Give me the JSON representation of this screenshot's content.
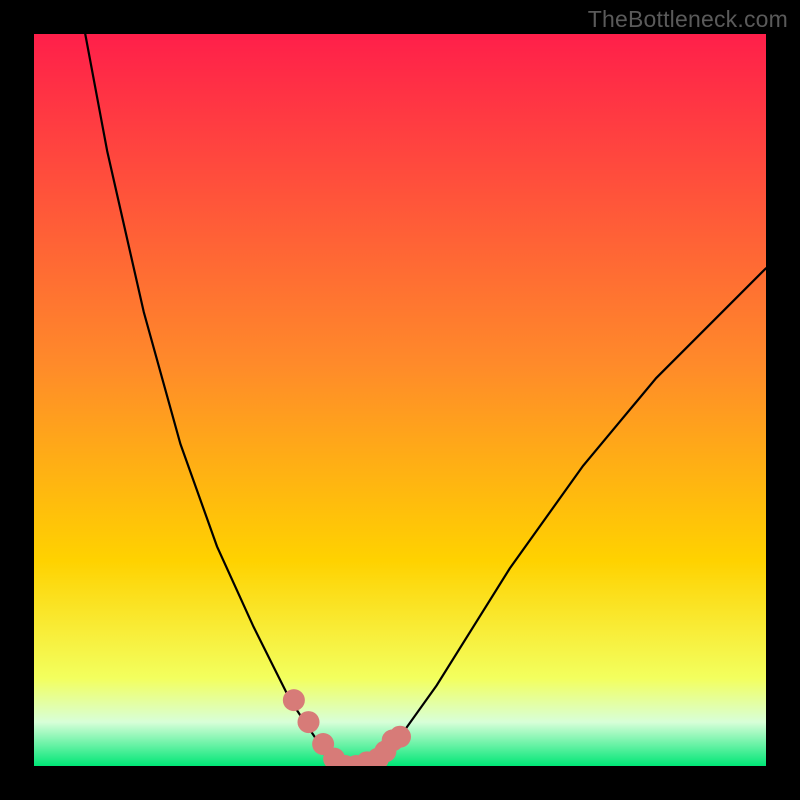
{
  "watermark": "TheBottleneck.com",
  "colors": {
    "frame": "#000000",
    "curve": "#000000",
    "marker_fill": "#d77b78",
    "marker_outline": "#d77b78",
    "grad_top": "#ff1f4a",
    "grad_mid": "#ffd200",
    "grad_low": "#f3ff5e",
    "grad_bottom_pale": "#d8ffd8",
    "grad_bottom": "#00e676"
  },
  "chart_data": {
    "type": "line",
    "title": "",
    "xlabel": "",
    "ylabel": "",
    "xlim": [
      0,
      100
    ],
    "ylim": [
      0,
      100
    ],
    "legend": false,
    "grid": false,
    "series": [
      {
        "name": "bottleneck-curve",
        "x": [
          7,
          10,
          15,
          20,
          25,
          30,
          33,
          35,
          37,
          39,
          40,
          42,
          44,
          47,
          50,
          55,
          60,
          65,
          70,
          75,
          80,
          85,
          90,
          95,
          100
        ],
        "values": [
          100,
          84,
          62,
          44,
          30,
          19,
          13,
          9,
          6,
          3,
          1,
          0,
          0,
          1,
          4,
          11,
          19,
          27,
          34,
          41,
          47,
          53,
          58,
          63,
          68
        ]
      }
    ],
    "markers": {
      "name": "highlight-dots",
      "x": [
        35.5,
        37.5,
        39.5,
        41.0,
        42.5,
        44.0,
        45.5,
        47.0,
        48.0,
        49.0,
        50.0
      ],
      "values": [
        9.0,
        6.0,
        3.0,
        1.0,
        0.0,
        0.0,
        0.5,
        1.0,
        2.0,
        3.5,
        4.0
      ]
    }
  }
}
